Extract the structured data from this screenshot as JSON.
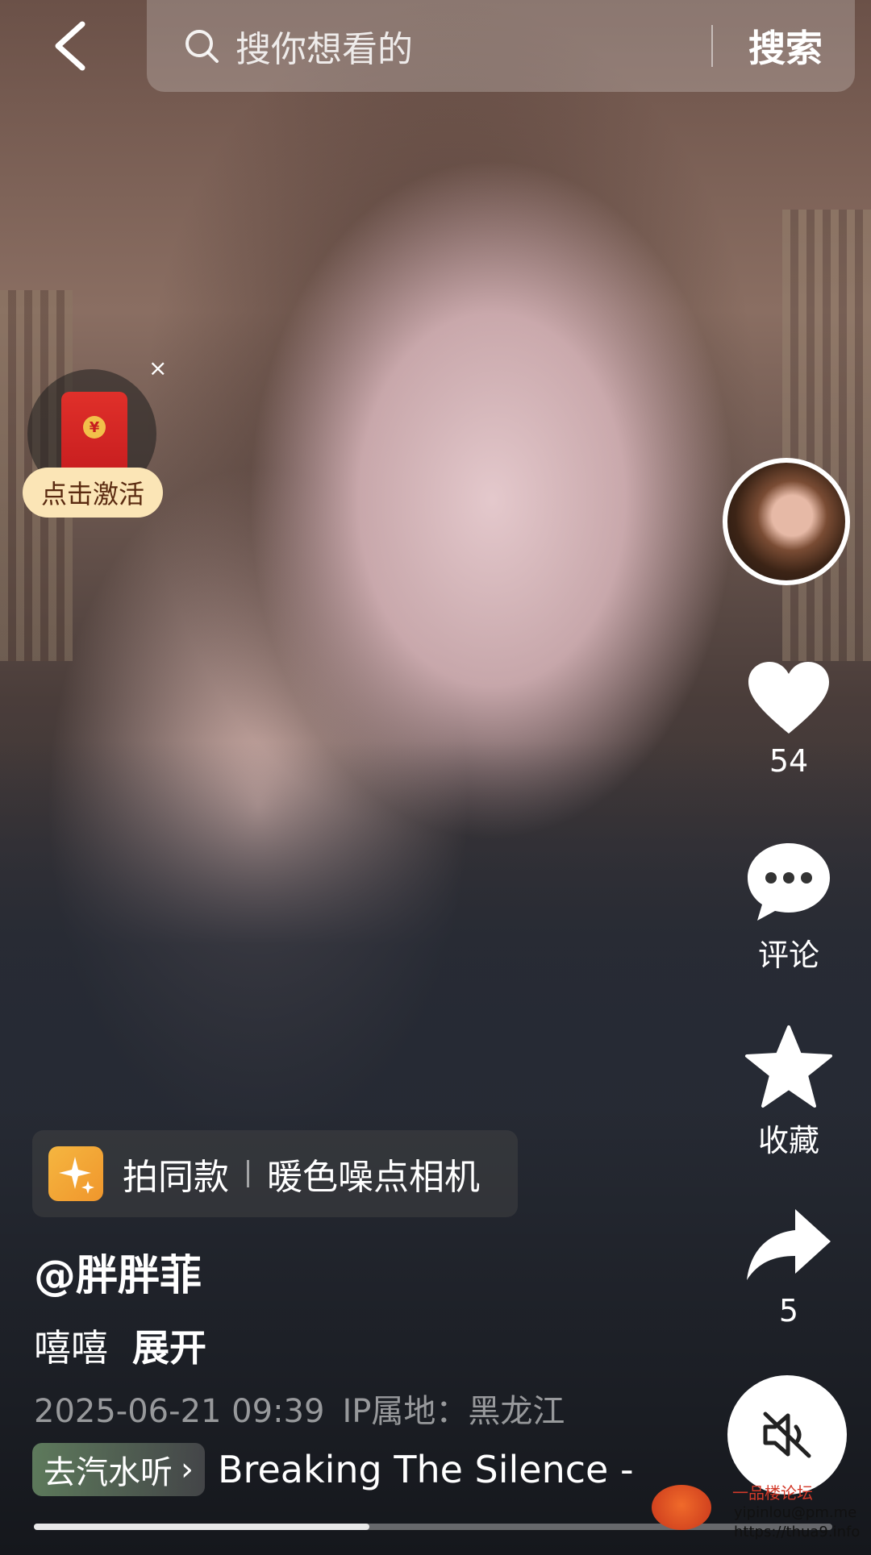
{
  "search": {
    "placeholder": "搜你想看的",
    "submit_label": "搜索"
  },
  "red_packet": {
    "coin_symbol": "¥",
    "close_label": "×",
    "activate_label": "点击激活"
  },
  "actions": {
    "like_count": "54",
    "comment_label": "评论",
    "favorite_label": "收藏",
    "share_count": "5"
  },
  "template": {
    "action_label": "拍同款",
    "effect_name": "暖色噪点相机"
  },
  "post": {
    "author": "@胖胖菲",
    "caption": "嘻嘻",
    "expand_label": "展开",
    "datetime": "2025-06-21 09:39",
    "ip_location": "IP属地：黑龙江"
  },
  "music": {
    "tag_label": "去汽水听",
    "title": "Breaking The Silence -"
  },
  "playback": {
    "progress_fraction": 0.42,
    "muted": true
  },
  "watermark": {
    "line1": "一品楼论坛",
    "line2": "yipinlou@pm.me",
    "line3": "https://thua9.info"
  },
  "colors": {
    "activate_bg": "#fbe5b6",
    "red_packet": "#d8261f",
    "sparkle_bg": "#f5b640"
  }
}
